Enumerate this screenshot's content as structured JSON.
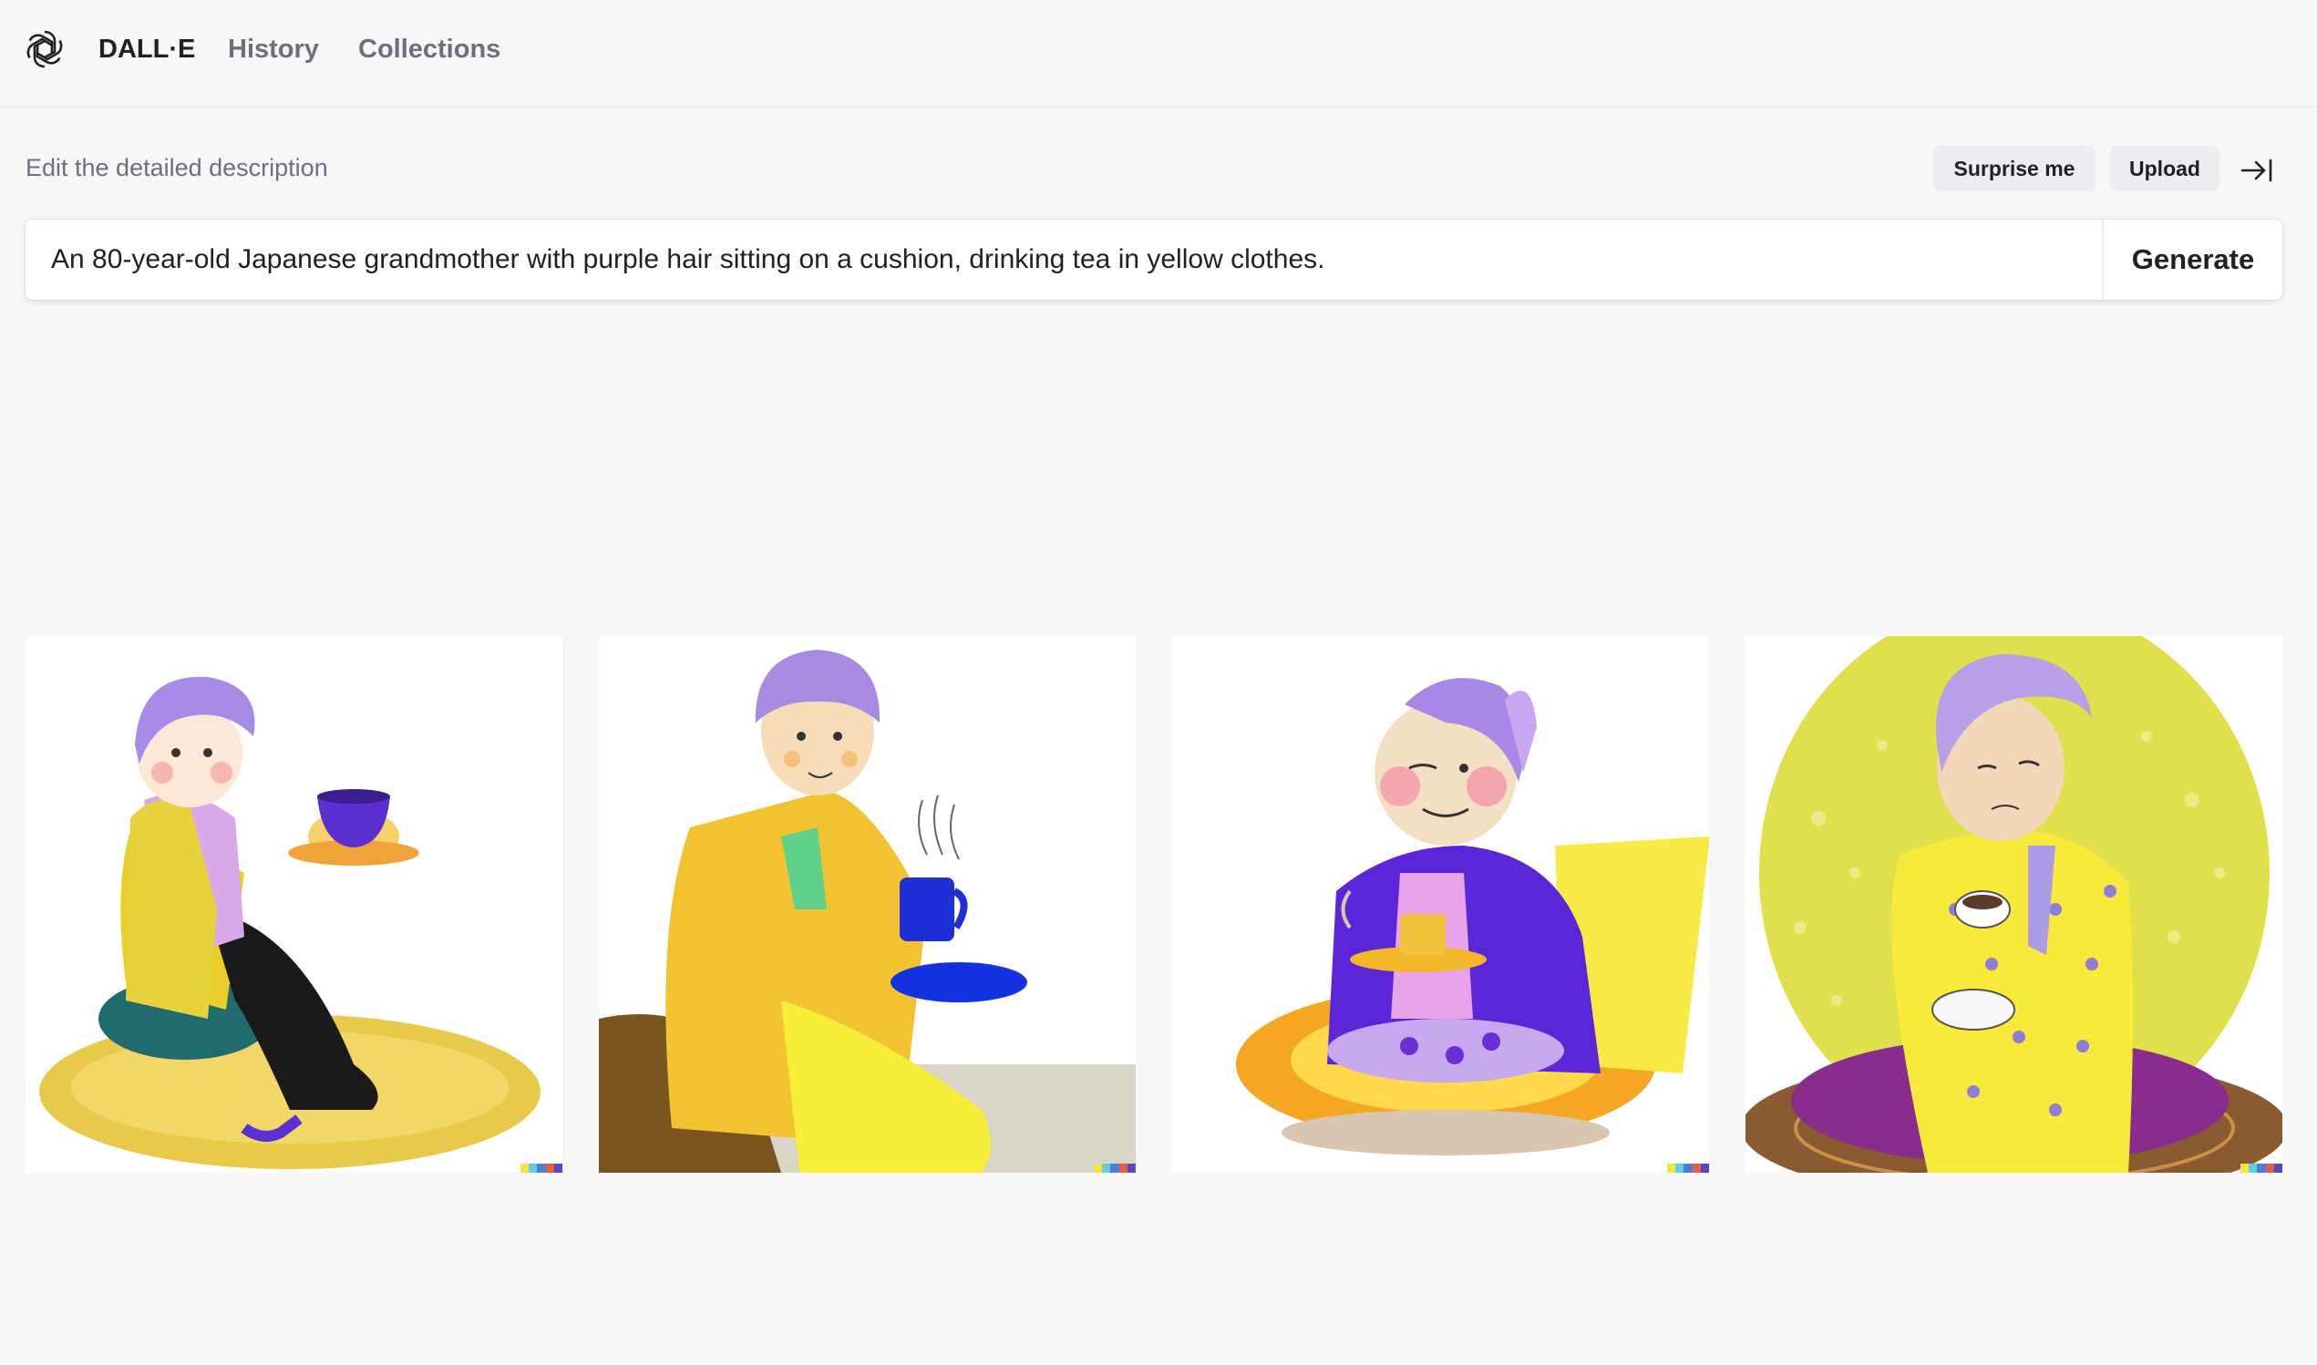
{
  "app": {
    "brand": "DALL·E",
    "nav": [
      "History",
      "Collections"
    ]
  },
  "editor": {
    "label": "Edit the detailed description",
    "surprise_label": "Surprise me",
    "upload_label": "Upload",
    "prompt_value": "An 80-year-old Japanese grandmother with purple hair sitting on a cushion, drinking tea in yellow clothes.",
    "generate_label": "Generate"
  },
  "results": [
    {
      "subject": "grandmother-seated-on-rug-holding-teacup"
    },
    {
      "subject": "grandmother-purple-cap-holding-blue-mug"
    },
    {
      "subject": "grandmother-on-glowing-cushion-with-tea"
    },
    {
      "subject": "grandmother-polka-dot-robe-yellow-circle"
    }
  ],
  "colors": {
    "background": "#f7f7f8",
    "text": "#202123",
    "muted": "#6e6e80",
    "button_bg": "#ececf1",
    "signature": [
      "#f4e542",
      "#61cfe3",
      "#4a7fd9",
      "#e85c3f",
      "#5b44c7"
    ]
  },
  "icons": {
    "logo": "openai-logo-icon",
    "collapse": "collapse-sidebar-icon"
  }
}
